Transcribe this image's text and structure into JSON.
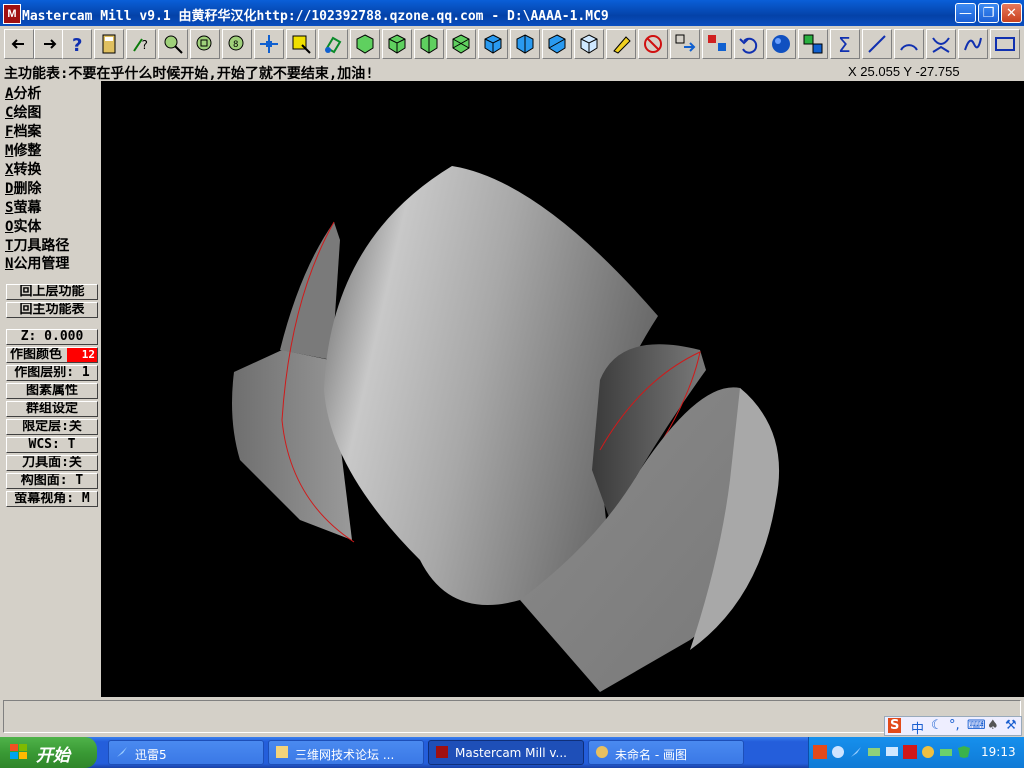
{
  "window": {
    "title": "Mastercam Mill v9.1 由黄秄华汉化http://102392788.qzone.qq.com  - D:\\AAAA-1.MC9",
    "app_icon_letter": "M",
    "minimize_icon": "minimize-icon",
    "maximize_icon": "restore-icon",
    "close_icon": "close-icon"
  },
  "toolbar": {
    "buttons": [
      "back-arrow-icon",
      "forward-arrow-icon",
      "help-icon",
      "calculator-icon",
      "query-icon",
      "zoom-window-icon",
      "zoom-fit-icon",
      "zoom-out-icon",
      "pan-icon",
      "select-icon",
      "rotate-view-icon",
      "cube-top-icon",
      "cube-front-icon",
      "cube-side-icon",
      "cube-iso-icon",
      "cube-view-1-icon",
      "cube-view-2-icon",
      "cube-view-3-icon",
      "cube-view-4-icon",
      "erase-icon",
      "no-entity-icon",
      "transform-icon",
      "group-icon",
      "undo-icon",
      "shade-sphere-icon",
      "copy-icon",
      "sum-icon",
      "line-icon",
      "arc-icon",
      "fillet-icon",
      "spline-icon",
      "rectangle-icon"
    ]
  },
  "prompt": {
    "text": "主功能表:不要在乎什么时候开始,开始了就不要结束,加油!",
    "coords": "X 25.055  Y -27.755"
  },
  "menu": {
    "items": [
      {
        "key": "A",
        "label": "分析"
      },
      {
        "key": "C",
        "label": "绘图"
      },
      {
        "key": "F",
        "label": "档案"
      },
      {
        "key": "M",
        "label": "修整"
      },
      {
        "key": "X",
        "label": "转换"
      },
      {
        "key": "D",
        "label": "删除"
      },
      {
        "key": "S",
        "label": "萤幕"
      },
      {
        "key": "O",
        "label": "实体"
      },
      {
        "key": "T",
        "label": "刀具路径"
      },
      {
        "key": "N",
        "label": "公用管理"
      }
    ],
    "back_prev": "回上层功能",
    "back_main": "回主功能表"
  },
  "params": {
    "z": "Z:  0.000",
    "color_label": "作图颜色",
    "color_value": "12",
    "color_hex": "#ff0000",
    "level": "作图层别: 1",
    "attributes": "图素属性",
    "group": "群组设定",
    "mask": "限定层:关",
    "wcs": "WCS:  T",
    "tplane": "刀具面:关",
    "cplane": "构图面: T",
    "gview": "萤幕视角: M"
  },
  "ime": {
    "logo": "S",
    "lang": "中"
  },
  "taskbar": {
    "start_label": "开始",
    "tasks": [
      {
        "label": "迅雷5",
        "icon": "thunder-icon"
      },
      {
        "label": "三维网技术论坛 ...",
        "icon": "browser-icon"
      },
      {
        "label": "Mastercam Mill v...",
        "icon": "mastercam-icon"
      },
      {
        "label": "未命名 - 画图",
        "icon": "paint-icon"
      }
    ],
    "clock": "19:13"
  },
  "colors": {
    "titlebar": "#0a5fd8",
    "viewport_bg": "#000000",
    "face": "#d4d0c8",
    "taskbar": "#245edb",
    "start": "#3a9a35"
  }
}
